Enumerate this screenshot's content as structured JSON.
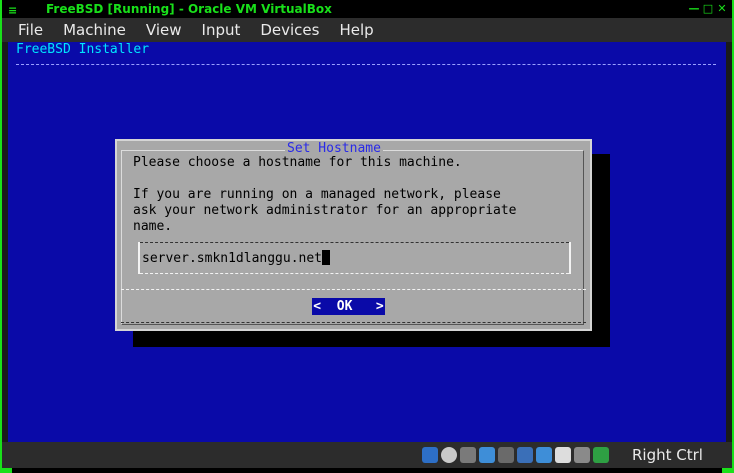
{
  "window": {
    "title": "FreeBSD [Running] - Oracle VM VirtualBox",
    "controls": [
      "minimize-icon",
      "maximize-icon",
      "close-icon"
    ]
  },
  "menu": [
    "File",
    "Machine",
    "View",
    "Input",
    "Devices",
    "Help"
  ],
  "installer": {
    "title": "FreeBSD Installer",
    "dialog": {
      "title": "Set Hostname",
      "line1": "Please choose a hostname for this machine.",
      "line2": "If you are running on a managed network, please",
      "line3": "ask your network administrator for an appropriate",
      "line4": "name.",
      "input_value": "server.smkn1dlanggu.net",
      "ok_label": "OK",
      "ok_left": "<",
      "ok_right": ">"
    }
  },
  "statusbar": {
    "icons": [
      "hard-disk-icon",
      "optical-drive-icon",
      "audio-icon",
      "usb-icon",
      "shared-folders-icon",
      "display-icon",
      "network-icon",
      "recording-icon",
      "mouse-integration-icon",
      "cpu-icon"
    ],
    "host_key": "Right Ctrl"
  },
  "colors": {
    "vm_background": "#0a0aa8",
    "dialog_background": "#a8a8a8",
    "title_accent": "#19e01a",
    "installer_title": "#00e5ff",
    "dialog_title": "#2a2ae8"
  }
}
